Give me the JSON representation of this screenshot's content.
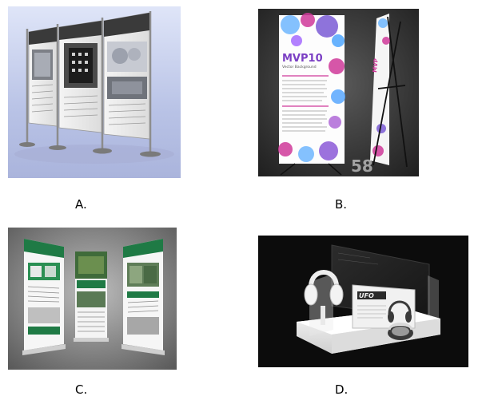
{
  "options": [
    {
      "id": "A",
      "label": "A."
    },
    {
      "id": "B",
      "label": "B."
    },
    {
      "id": "C",
      "label": "C."
    },
    {
      "id": "D",
      "label": "D."
    }
  ],
  "photos": {
    "a": {
      "subject": "three-panel-exhibition-display-stand"
    },
    "b": {
      "subject": "x-frame-banner-stand",
      "banner_title": "MVP10",
      "banner_subtitle": "Vector Background"
    },
    "c": {
      "subject": "roll-up-banner-stands"
    },
    "d": {
      "subject": "headphone-product-display-stand"
    }
  },
  "colors": {
    "a_background": "#b9c3e6",
    "b_background": "#2c2c2c",
    "c_background": "#6c6c6c",
    "d_background": "#0c0c0c",
    "banner_green": "#1f7a45",
    "banner_magenta": "#d03a9a"
  }
}
